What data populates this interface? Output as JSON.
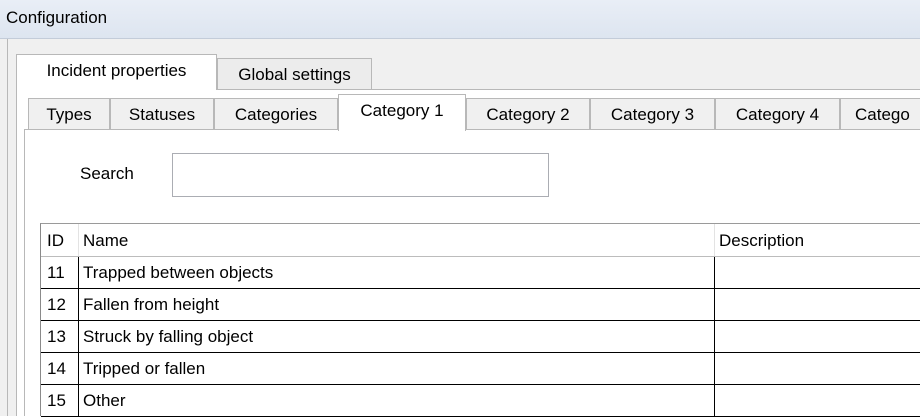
{
  "window": {
    "title": "Configuration"
  },
  "outer_tabs": [
    {
      "label": "Incident properties",
      "active": true
    },
    {
      "label": "Global settings",
      "active": false
    }
  ],
  "inner_tabs": [
    {
      "label": "Types"
    },
    {
      "label": "Statuses"
    },
    {
      "label": "Categories"
    },
    {
      "label": "Category 1",
      "active": true
    },
    {
      "label": "Category 2"
    },
    {
      "label": "Category 3"
    },
    {
      "label": "Category 4"
    },
    {
      "label": "Catego"
    }
  ],
  "search": {
    "label": "Search",
    "value": ""
  },
  "table": {
    "columns": [
      "ID",
      "Name",
      "Description"
    ],
    "rows": [
      {
        "id": "11",
        "name": "Trapped between objects",
        "description": ""
      },
      {
        "id": "12",
        "name": "Fallen from height",
        "description": ""
      },
      {
        "id": "13",
        "name": "Struck by falling object",
        "description": ""
      },
      {
        "id": "14",
        "name": "Tripped or fallen",
        "description": ""
      },
      {
        "id": "15",
        "name": "Other",
        "description": ""
      }
    ]
  }
}
